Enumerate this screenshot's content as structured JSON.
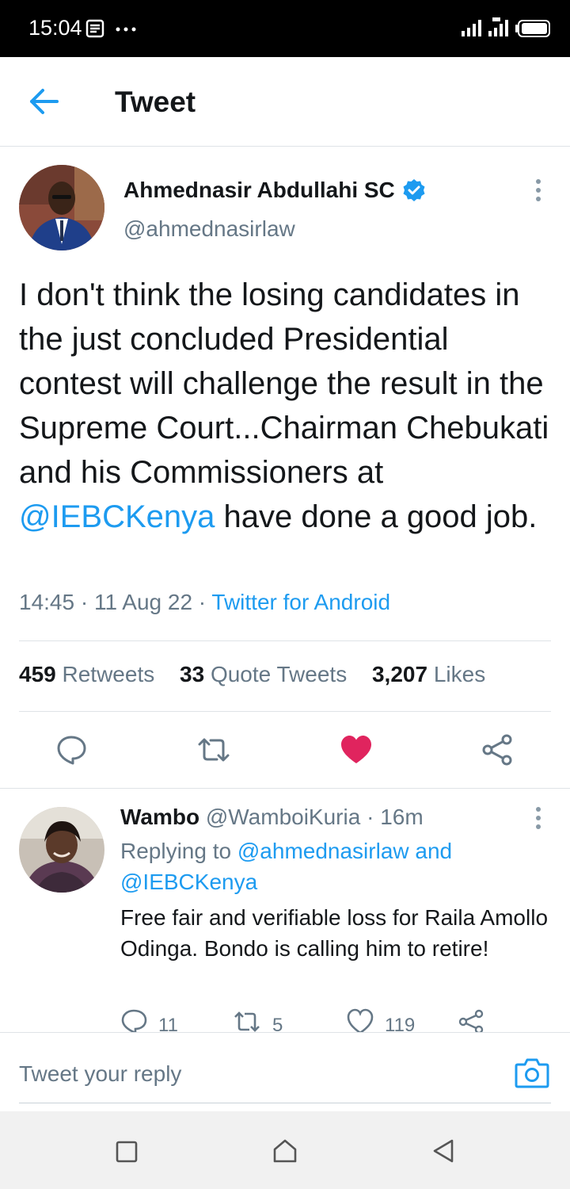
{
  "status_bar": {
    "time": "15:04"
  },
  "header": {
    "title": "Tweet"
  },
  "tweet": {
    "author_name": "Ahmednasir Abdullahi SC",
    "author_handle": "@ahmednasirlaw",
    "text_part1": "I don't think the losing candidates in the just concluded Presidential contest will challenge the result in the Supreme Court...Chairman Chebukati and his Commissioners at ",
    "mention": "@IEBCKenya",
    "text_part2": " have done a good job.",
    "time": "14:45",
    "date": "11 Aug 22",
    "source": "Twitter for Android",
    "separator": "·",
    "stats": {
      "retweets_count": "459",
      "retweets_label": "Retweets",
      "quotes_count": "33",
      "quotes_label": "Quote Tweets",
      "likes_count": "3,207",
      "likes_label": "Likes"
    }
  },
  "reply": {
    "author_name": "Wambo",
    "author_handle": "@WamboiKuria",
    "time_ago": "16m",
    "separator": "·",
    "replying_to_label": "Replying to",
    "replying_to_handle": "@ahmednasirlaw",
    "replying_and": "and",
    "replying_to_handle2": "@IEBCKenya",
    "text": "Free fair and verifiable loss for Raila Amollo Odinga. Bondo is calling him to retire!",
    "reply_count": "11",
    "retweet_count": "5",
    "like_count": "119"
  },
  "composer": {
    "placeholder": "Tweet your reply"
  },
  "colors": {
    "accent": "#1d9bf0",
    "like": "#e0245e",
    "secondary_text": "#657786"
  }
}
